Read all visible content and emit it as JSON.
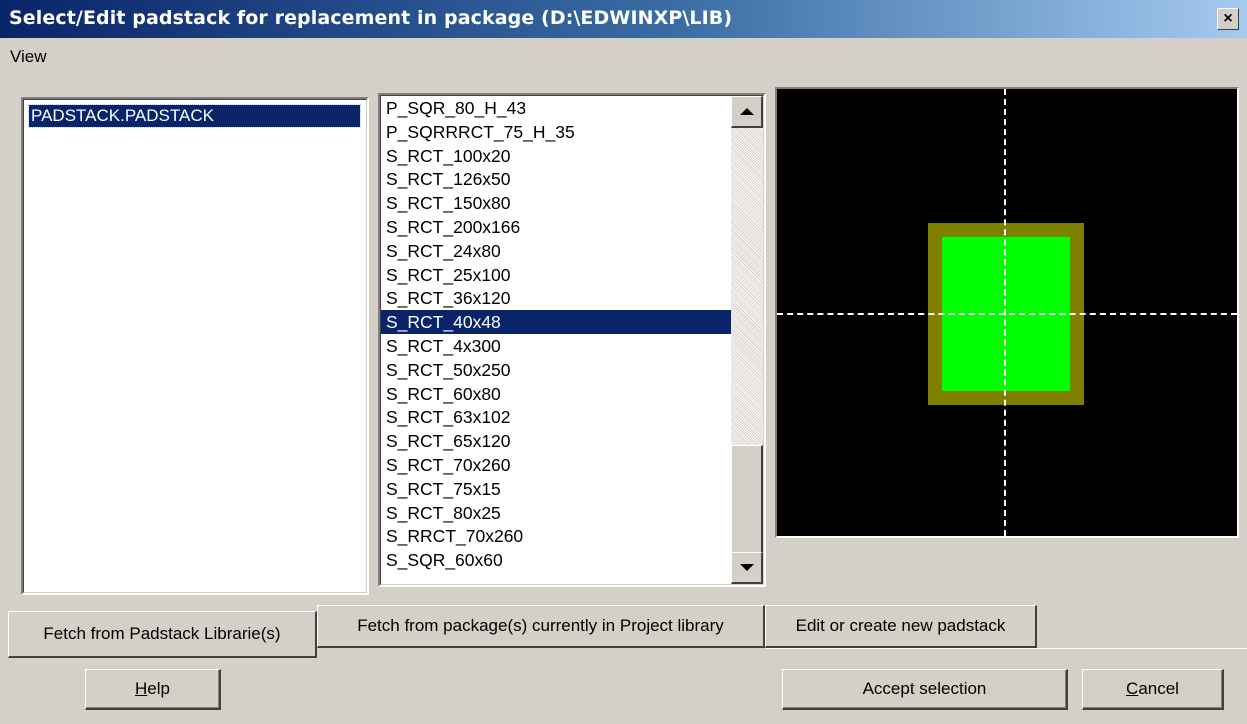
{
  "window": {
    "title": "Select/Edit padstack for replacement in package (D:\\EDWINXP\\LIB)",
    "close_glyph": "×"
  },
  "menu": {
    "view": "View"
  },
  "libraries": {
    "items": [
      "PADSTACK.PADSTACK"
    ],
    "selected": "PADSTACK.PADSTACK"
  },
  "padstacks": {
    "items": [
      "P_SQR_80_H_43",
      "P_SQRRRCT_75_H_35",
      "S_RCT_100x20",
      "S_RCT_126x50",
      "S_RCT_150x80",
      "S_RCT_200x166",
      "S_RCT_24x80",
      "S_RCT_25x100",
      "S_RCT_36x120",
      "S_RCT_40x48",
      "S_RCT_4x300",
      "S_RCT_50x250",
      "S_RCT_60x80",
      "S_RCT_63x102",
      "S_RCT_65x120",
      "S_RCT_70x260",
      "S_RCT_75x15",
      "S_RCT_80x25",
      "S_RRCT_70x260",
      "S_SQR_60x60"
    ],
    "selected_index": 9
  },
  "preview": {
    "background": "#000000",
    "pad_color": "#00ff00",
    "outline_color": "#808000",
    "crosshair_color": "#ffffff"
  },
  "tabs": [
    {
      "label": "Fetch from Padstack Librarie(s)",
      "active": true
    },
    {
      "label": "Fetch from package(s) currently in Project library",
      "active": false
    },
    {
      "label": "Edit or create new padstack",
      "active": false
    }
  ],
  "buttons": {
    "help_mnemonic": "H",
    "help_rest": "elp",
    "accept": "Accept selection",
    "cancel_mnemonic": "C",
    "cancel_rest": "ancel"
  }
}
